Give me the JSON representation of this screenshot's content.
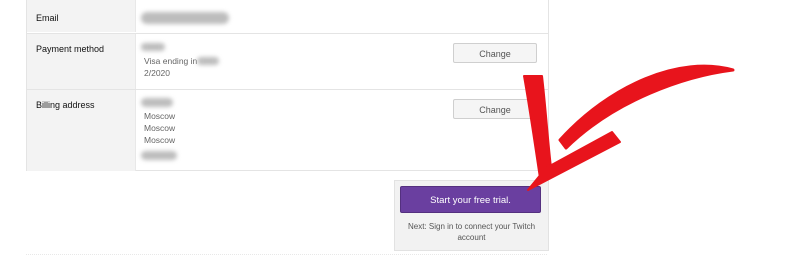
{
  "billing": {
    "email": {
      "label": "Email"
    },
    "payment": {
      "label": "Payment method",
      "card_prefix": "Visa ending in",
      "expiry": "2/2020",
      "change_label": "Change"
    },
    "address": {
      "label": "Billing address",
      "lines": [
        "Moscow",
        "Moscow",
        "Moscow"
      ],
      "change_label": "Change"
    }
  },
  "trial": {
    "button_label": "Start your free trial.",
    "note": "Next: Sign in to connect your Twitch account"
  },
  "colors": {
    "trial_button": "#6a3fa0",
    "annotation_arrow": "#e8141c"
  },
  "icons": {
    "annotation": "arrow-annotation-icon"
  }
}
